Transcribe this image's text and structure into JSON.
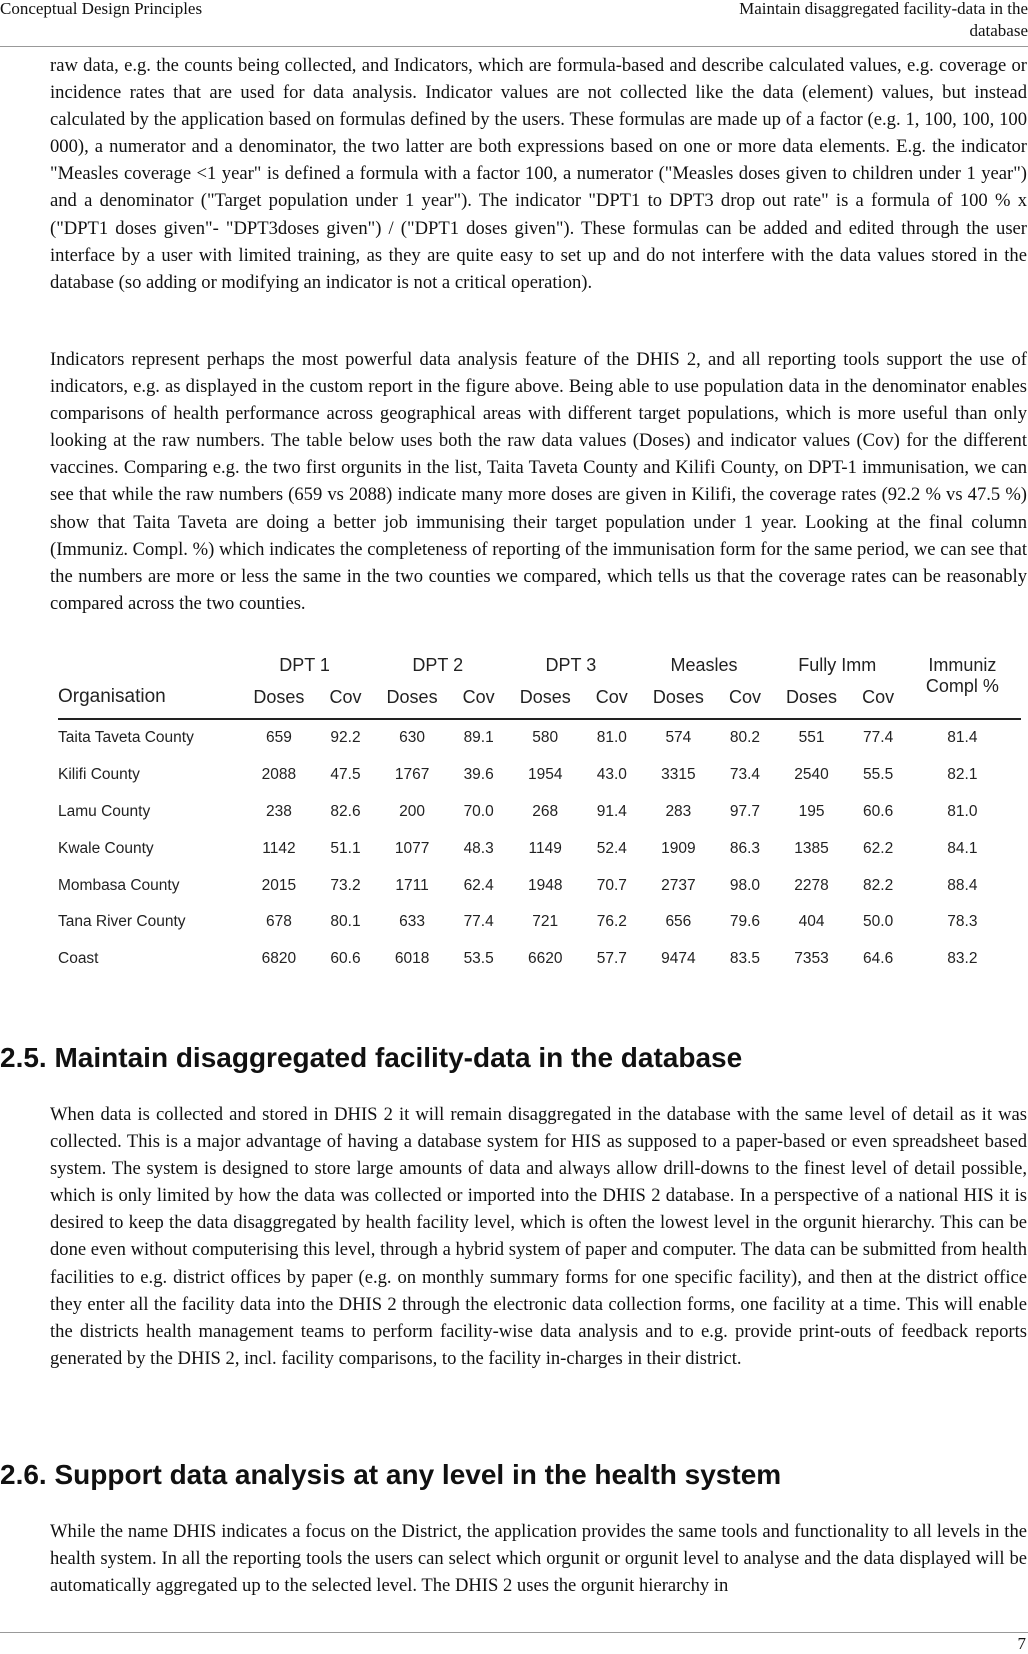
{
  "header": {
    "left": "Conceptual Design Principles",
    "right": "Maintain disaggregated facility-data in the database"
  },
  "paragraphs": [
    "raw data, e.g. the counts being collected, and Indicators, which are formula-based and describe calculated values, e.g. coverage or incidence rates that are used for data analysis. Indicator values are not collected like the data (element) values, but instead calculated by the application based on formulas defined by the users. These formulas are made up of a factor (e.g. 1, 100, 100, 100 000), a numerator and a denominator, the two latter are both expressions based on one or more data elements. E.g. the indicator \"Measles coverage <1 year\" is defined a formula with a factor 100, a numerator (\"Measles doses given to children under 1 year\") and a denominator (\"Target population under 1 year\"). The indicator \"DPT1 to DPT3 drop out rate\" is a formula of 100 % x (\"DPT1 doses given\"- \"DPT3doses given\") / (\"DPT1 doses given\"). These formulas can be added and edited through the user interface by a user with limited training, as they are quite easy to set up and do not interfere with the data values stored in the database (so adding or modifying an indicator is not a critical operation).",
    "Indicators represent perhaps the most powerful data analysis feature of the DHIS 2, and all reporting tools support the use of indicators, e.g. as displayed in the custom report in the figure above. Being able to use population data in the denominator enables comparisons of health performance across geographical areas with different target populations, which is more useful than only looking at the raw numbers. The table below uses both the raw data values (Doses) and indicator values (Cov) for the different vaccines. Comparing e.g. the two first orgunits in the list, Taita Taveta County and Kilifi County, on DPT-1 immunisation, we can see that while the raw numbers (659 vs 2088) indicate many more doses are given in Kilifi, the coverage rates (92.2 % vs 47.5 %) show that Taita Taveta are doing a better job immunising their target population under 1 year. Looking at the final column (Immuniz. Compl. %) which indicates the completeness of reporting of the immunisation form for the same period, we can see that the numbers are more or less the same in the two counties we compared, which tells us that the coverage rates can be reasonably compared across the two counties."
  ],
  "table": {
    "org_header": "Organisation",
    "groups": [
      "DPT 1",
      "DPT 2",
      "DPT 3",
      "Measles",
      "Fully Imm"
    ],
    "sub": {
      "doses": "Doses",
      "cov": "Cov"
    },
    "last_header_1": "Immuniz",
    "last_header_2": "Compl %",
    "rows": [
      [
        "Taita Taveta County",
        "659",
        "92.2",
        "630",
        "89.1",
        "580",
        "81.0",
        "574",
        "80.2",
        "551",
        "77.4",
        "81.4"
      ],
      [
        "Kilifi County",
        "2088",
        "47.5",
        "1767",
        "39.6",
        "1954",
        "43.0",
        "3315",
        "73.4",
        "2540",
        "55.5",
        "82.1"
      ],
      [
        "Lamu County",
        "238",
        "82.6",
        "200",
        "70.0",
        "268",
        "91.4",
        "283",
        "97.7",
        "195",
        "60.6",
        "81.0"
      ],
      [
        "Kwale County",
        "1142",
        "51.1",
        "1077",
        "48.3",
        "1149",
        "52.4",
        "1909",
        "86.3",
        "1385",
        "62.2",
        "84.1"
      ],
      [
        "Mombasa County",
        "2015",
        "73.2",
        "1711",
        "62.4",
        "1948",
        "70.7",
        "2737",
        "98.0",
        "2278",
        "82.2",
        "88.4"
      ],
      [
        "Tana River County",
        "678",
        "80.1",
        "633",
        "77.4",
        "721",
        "76.2",
        "656",
        "79.6",
        "404",
        "50.0",
        "78.3"
      ],
      [
        "Coast",
        "6820",
        "60.6",
        "6018",
        "53.5",
        "6620",
        "57.7",
        "9474",
        "83.5",
        "7353",
        "64.6",
        "83.2"
      ]
    ]
  },
  "section_25": {
    "title": "2.5. Maintain disaggregated facility-data in the database",
    "text": "When data is collected and stored in DHIS 2 it will remain disaggregated in the database with the same level of detail as it was collected. This is a major advantage of having a database system for HIS as supposed to a paper-based or even spreadsheet based system. The system is designed to store large amounts of data and always allow drill-downs to the finest level of detail possible, which is only limited by how the data was collected or imported into the DHIS 2 database. In a perspective of a national HIS it is desired to keep the data disaggregated by health facility level, which is often the lowest level in the orgunit hierarchy. This can be done even without computerising this level, through a hybrid system of paper and computer. The data can be submitted from health facilities to e.g. district offices by paper (e.g. on monthly summary forms for one specific facility), and then at the district office they enter all the facility data into the DHIS 2 through the electronic data collection forms, one facility at a time. This will enable the districts health management teams to perform facility-wise data analysis and to e.g. provide print-outs of feedback reports generated by the DHIS 2, incl. facility comparisons, to the facility in-charges in their district."
  },
  "section_26": {
    "title": "2.6. Support data analysis at any level in the health system",
    "text": "While the name DHIS indicates a focus on the District, the application provides the same tools and functionality to all levels in the health system. In all the reporting tools the users can select which orgunit or orgunit level to analyse and the data displayed will be automatically aggregated up to the selected level. The DHIS 2 uses the orgunit hierarchy in"
  },
  "page_number": "7"
}
